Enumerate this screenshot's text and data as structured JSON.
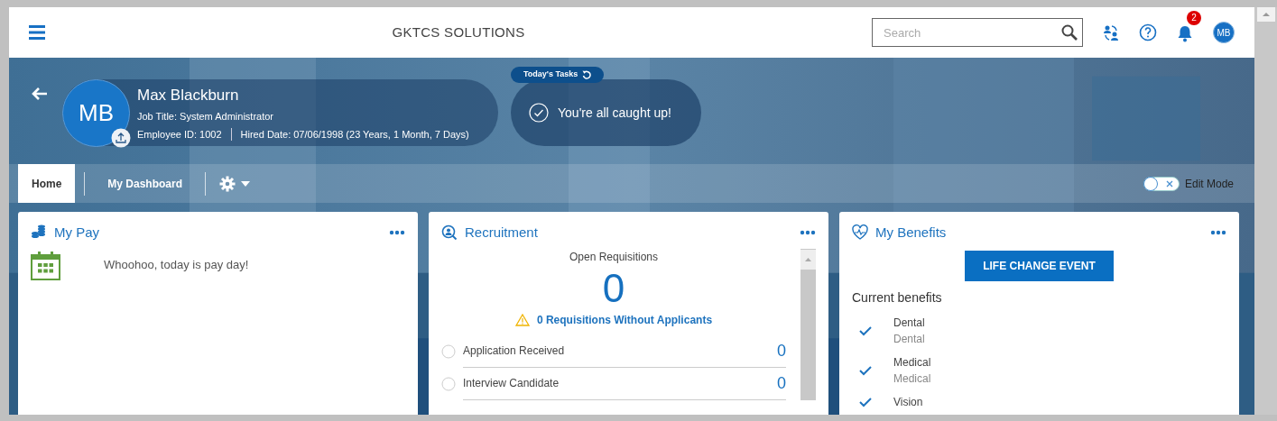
{
  "header": {
    "title": "GKTCS SOLUTIONS",
    "search": {
      "placeholder": "Search"
    },
    "notifications": {
      "count": "2"
    },
    "avatar": "MB"
  },
  "profile": {
    "initials": "MB",
    "name": "Max Blackburn",
    "job_title": "Job Title: System Administrator",
    "employee_id": "Employee ID: 1002",
    "hired": "Hired Date: 07/06/1998 (23 Years, 1 Month, 7 Days)"
  },
  "tasks": {
    "label": "Today's Tasks",
    "message": "You're all caught up!"
  },
  "tabs": [
    {
      "label": "Home",
      "selected": true
    },
    {
      "label": "My Dashboard",
      "selected": false
    }
  ],
  "edit_mode": {
    "label": "Edit Mode",
    "on": false
  },
  "cards": [
    {
      "kind": "pay",
      "title": "My Pay",
      "message": "Whoohoo, today is pay day!"
    },
    {
      "kind": "recruitment",
      "title": "Recruitment",
      "subtitle": "Open Requisitions",
      "count": "0",
      "warning": "0 Requisitions Without Applicants",
      "stages": [
        {
          "label": "Application Received",
          "count": "0"
        },
        {
          "label": "Interview Candidate",
          "count": "0"
        }
      ]
    },
    {
      "kind": "benefits",
      "title": "My Benefits",
      "button": "LIFE CHANGE EVENT",
      "heading": "Current benefits",
      "benefits": [
        {
          "name": "Dental",
          "plan": "Dental"
        },
        {
          "name": "Medical",
          "plan": "Medical"
        },
        {
          "name": "Vision"
        }
      ]
    }
  ]
}
